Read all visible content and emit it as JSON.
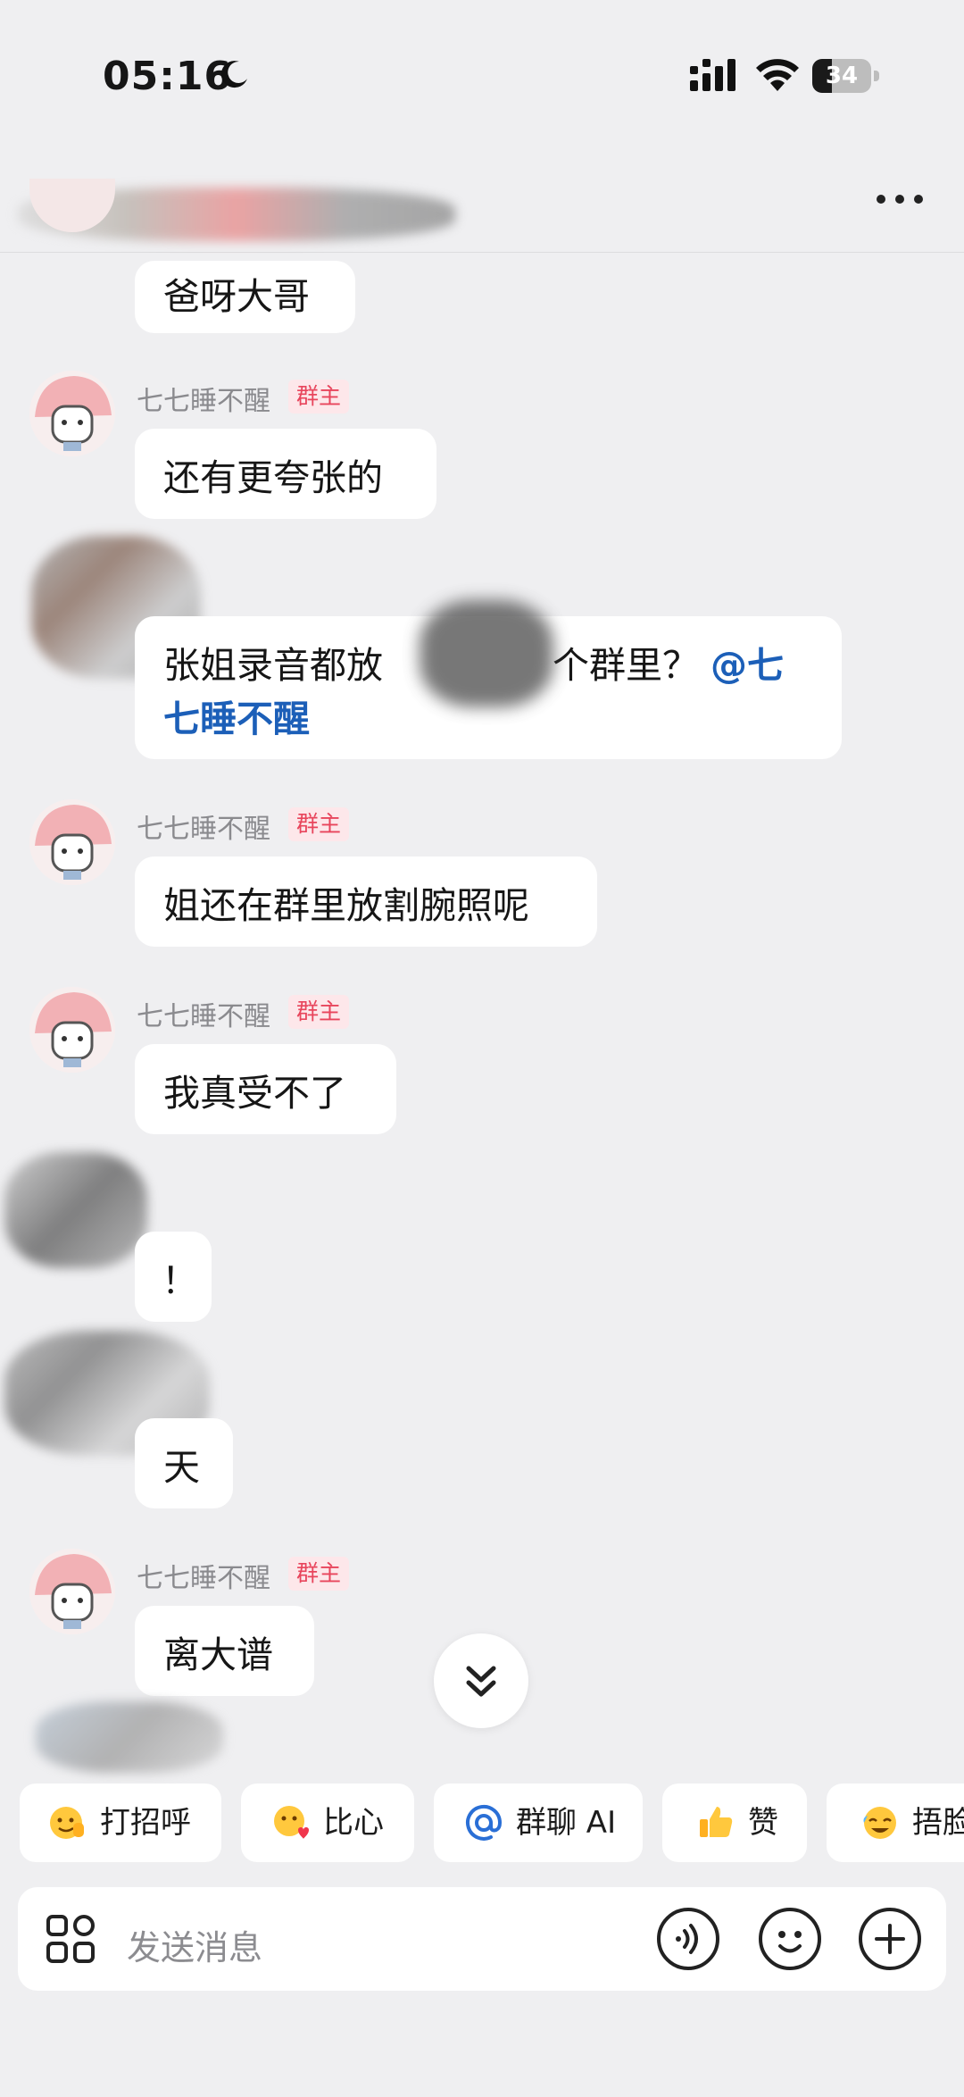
{
  "status_bar": {
    "time": "05:16",
    "battery": "34",
    "battery_level": 0.34
  },
  "top_bar": {
    "more_icon": "more-dots-icon"
  },
  "messages": [
    {
      "sender": "",
      "text": "爸呀大哥"
    },
    {
      "sender": "七七睡不醒",
      "badge": "群主",
      "text": "还有更夸张的"
    },
    {
      "sender": "",
      "text_line1_a": "张姐录音都放",
      "text_line1_b": "个群里？",
      "mention_a": "@七",
      "mention_b": "七睡不醒"
    },
    {
      "sender": "七七睡不醒",
      "badge": "群主",
      "text": "姐还在群里放割腕照呢"
    },
    {
      "sender": "七七睡不醒",
      "badge": "群主",
      "text": "我真受不了"
    },
    {
      "sender": "",
      "text": "！"
    },
    {
      "sender": "",
      "text": "天"
    },
    {
      "sender": "七七睡不醒",
      "badge": "群主",
      "text": "离大谱"
    }
  ],
  "quick_replies": [
    {
      "label": "打招呼",
      "icon": "wave-emoji-icon"
    },
    {
      "label": "比心",
      "icon": "heart-hands-emoji-icon"
    },
    {
      "label": "群聊 AI",
      "icon": "at-icon"
    },
    {
      "label": "赞",
      "icon": "thumbs-up-emoji-icon"
    },
    {
      "label": "捂脸",
      "icon": "facepalm-emoji-icon"
    }
  ],
  "input": {
    "placeholder": "发送消息"
  },
  "colors": {
    "background": "#efeff1",
    "bubble": "#ffffff",
    "mention": "#1c5fb8",
    "badge_text": "#e8455c",
    "badge_bg": "#fde7ea"
  }
}
